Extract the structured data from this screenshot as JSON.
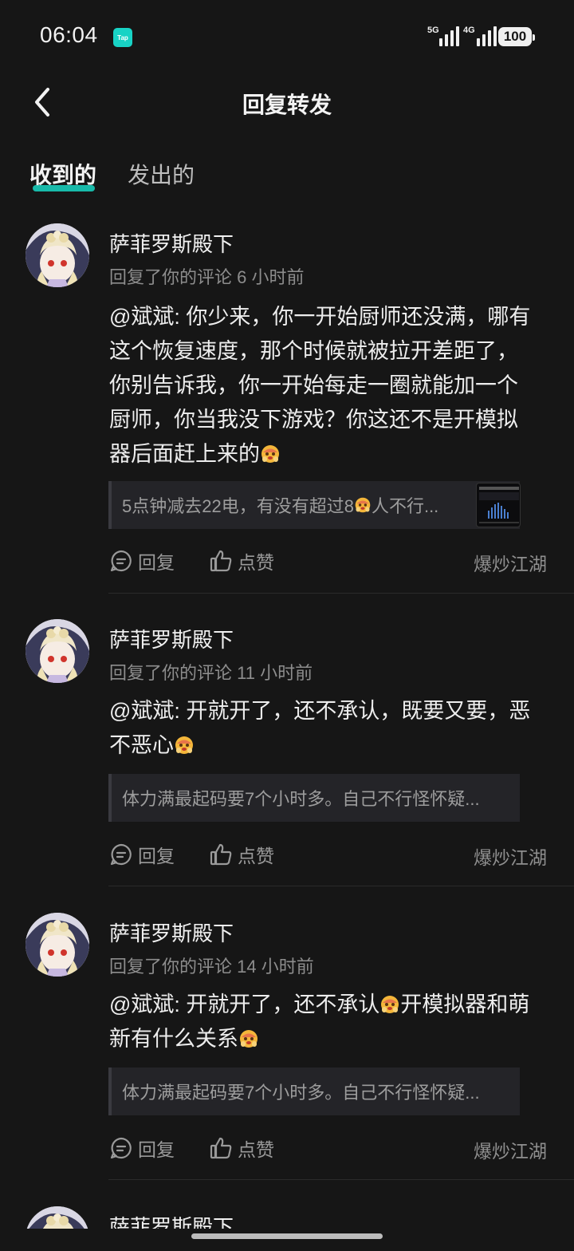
{
  "status_bar": {
    "time": "06:04",
    "app_badge": "Tap",
    "signal_labels": [
      "5G",
      "4G"
    ],
    "battery": "100"
  },
  "header": {
    "title": "回复转发",
    "back_icon": "chevron-left-icon"
  },
  "tabs": [
    {
      "label": "收到的",
      "active": true
    },
    {
      "label": "发出的",
      "active": false
    }
  ],
  "comments": [
    {
      "user": "萨菲罗斯殿下",
      "meta": "回复了你的评论 6 小时前",
      "lines": [
        "@斌斌: 你少来，你一开始厨师还没满，哪有",
        "这个恢复速度，那个时候就被拉开差距了，",
        "你别告诉我，你一开始每走一圈就能加一个",
        "厨师，你当我没下游戏？你这还不是开模拟",
        "器后面赶上来的"
      ],
      "quote_a": "5点钟减去22电，有没有超过8",
      "quote_b": "人不行...",
      "reply_label": "回复",
      "like_label": "点赞",
      "source": "爆炒江湖"
    },
    {
      "user": "萨菲罗斯殿下",
      "meta": "回复了你的评论 11 小时前",
      "lines": [
        "@斌斌: 开就开了，还不承认，既要又要，恶",
        "不恶心"
      ],
      "quote_a": "体力满最起码要7个小时多。自己不行怪怀疑...",
      "reply_label": "回复",
      "like_label": "点赞",
      "source": "爆炒江湖"
    },
    {
      "user": "萨菲罗斯殿下",
      "meta": "回复了你的评论 14 小时前",
      "line1_a": "@斌斌: 开就开了，还不承认",
      "line1_b": "开模拟器和萌",
      "line2": "新有什么关系",
      "quote_a": "体力满最起码要7个小时多。自己不行怪怀疑...",
      "reply_label": "回复",
      "like_label": "点赞",
      "source": "爆炒江湖"
    },
    {
      "user": "萨菲罗斯殿下"
    }
  ],
  "colors": {
    "background": "#161616",
    "accent": "#18b9a9",
    "tap_badge": "#18d3c5"
  }
}
